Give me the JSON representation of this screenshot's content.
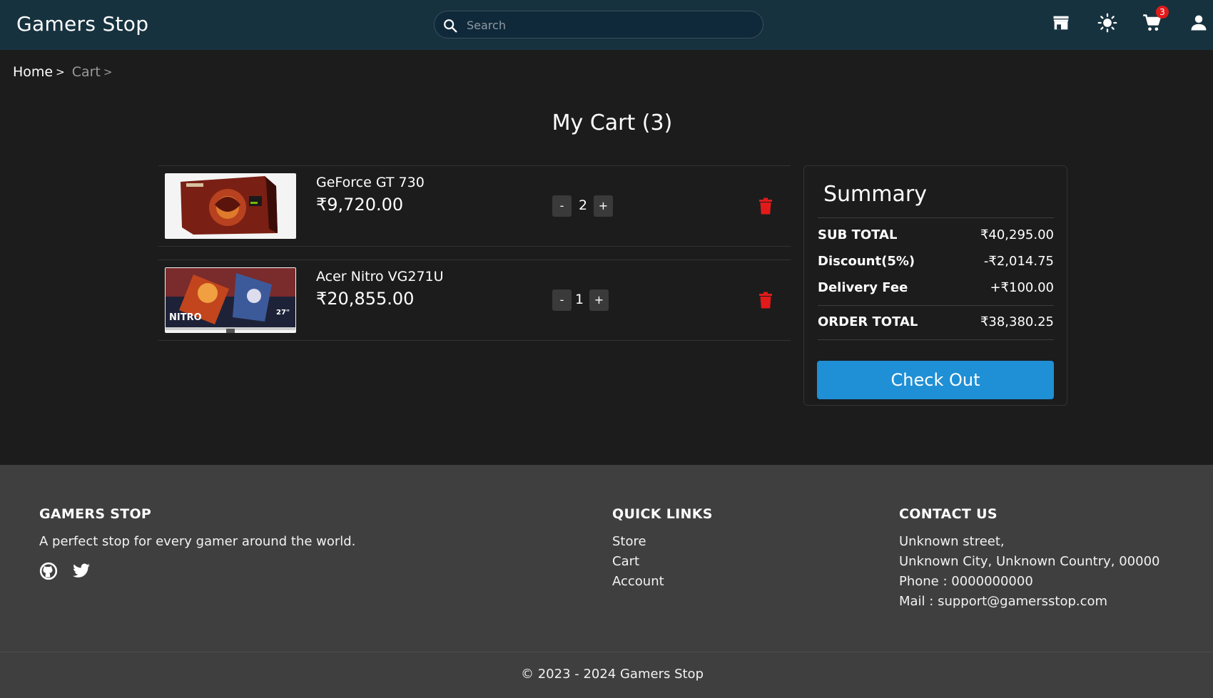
{
  "app": {
    "brand": "Gamers Stop"
  },
  "search": {
    "placeholder": "Search"
  },
  "navbar": {
    "cart_count": "3"
  },
  "breadcrumb": {
    "home": "Home",
    "current": "Cart",
    "separator": ">"
  },
  "page": {
    "title": "My Cart (3)"
  },
  "cart": {
    "items": [
      {
        "name": "GeForce GT 730",
        "price": "₹9,720.00",
        "quantity": "2",
        "minus": "-",
        "plus": "+"
      },
      {
        "name": "Acer Nitro VG271U",
        "price": "₹20,855.00",
        "quantity": "1",
        "minus": "-",
        "plus": "+"
      }
    ]
  },
  "summary": {
    "title": "Summary",
    "rows": [
      {
        "label": "SUB TOTAL",
        "value": "₹40,295.00"
      },
      {
        "label": "Discount(5%)",
        "value": "-₹2,014.75"
      },
      {
        "label": "Delivery Fee",
        "value": "+₹100.00"
      }
    ],
    "total": {
      "label": "ORDER TOTAL",
      "value": "₹38,380.25"
    },
    "checkout_label": "Check Out"
  },
  "footer": {
    "about": {
      "heading": "GAMERS STOP",
      "text": "A perfect stop for every gamer around the world."
    },
    "links": {
      "heading": "QUICK LINKS",
      "items": [
        "Store",
        "Cart",
        "Account"
      ]
    },
    "contact": {
      "heading": "CONTACT US",
      "lines": [
        "Unknown street,",
        "Unknown City, Unknown Country, 00000",
        "Phone : 0000000000",
        "Mail : support@gamersstop.com"
      ]
    },
    "copyright": "© 2023 - 2024 Gamers Stop"
  },
  "colors": {
    "navbar": "#17323f",
    "body": "#1c1c1c",
    "footer": "#3f3f3f",
    "accent": "#1f8fd6",
    "danger": "#e21a1a"
  },
  "icons": [
    "search-icon",
    "store-icon",
    "theme-sun-icon",
    "cart-icon",
    "user-icon",
    "trash-icon",
    "github-icon",
    "twitter-icon"
  ]
}
